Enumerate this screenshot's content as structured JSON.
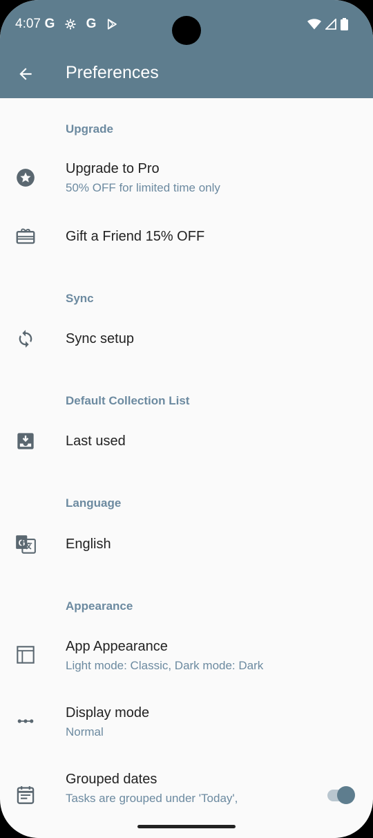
{
  "status_bar": {
    "time": "4:07",
    "left_icons": [
      "google-icon",
      "settings-icon",
      "google-icon",
      "play-store-icon"
    ],
    "right_icons": [
      "wifi-icon",
      "signal-icon",
      "battery-icon"
    ]
  },
  "app_bar": {
    "title": "Preferences",
    "background_color": "#5e7d8e"
  },
  "sections": {
    "upgrade": {
      "header": "Upgrade",
      "upgrade_pro": {
        "title": "Upgrade to Pro",
        "summary": "50% OFF for limited time only"
      },
      "gift": {
        "title": "Gift a Friend 15% OFF"
      }
    },
    "sync": {
      "header": "Sync",
      "sync_setup": {
        "title": "Sync setup"
      }
    },
    "default_collection": {
      "header": "Default Collection List",
      "last_used": {
        "title": "Last used"
      }
    },
    "language": {
      "header": "Language",
      "english": {
        "title": "English"
      }
    },
    "appearance": {
      "header": "Appearance",
      "app_appearance": {
        "title": "App Appearance",
        "summary": "Light mode: Classic, Dark mode: Dark"
      },
      "display_mode": {
        "title": "Display mode",
        "summary": "Normal"
      },
      "grouped_dates": {
        "title": "Grouped dates",
        "summary": "Tasks are grouped under 'Today',",
        "toggle_on": true
      }
    }
  },
  "colors": {
    "accent": "#5e7d8e",
    "section_header": "#6c8aa0",
    "background": "#fafafa"
  }
}
